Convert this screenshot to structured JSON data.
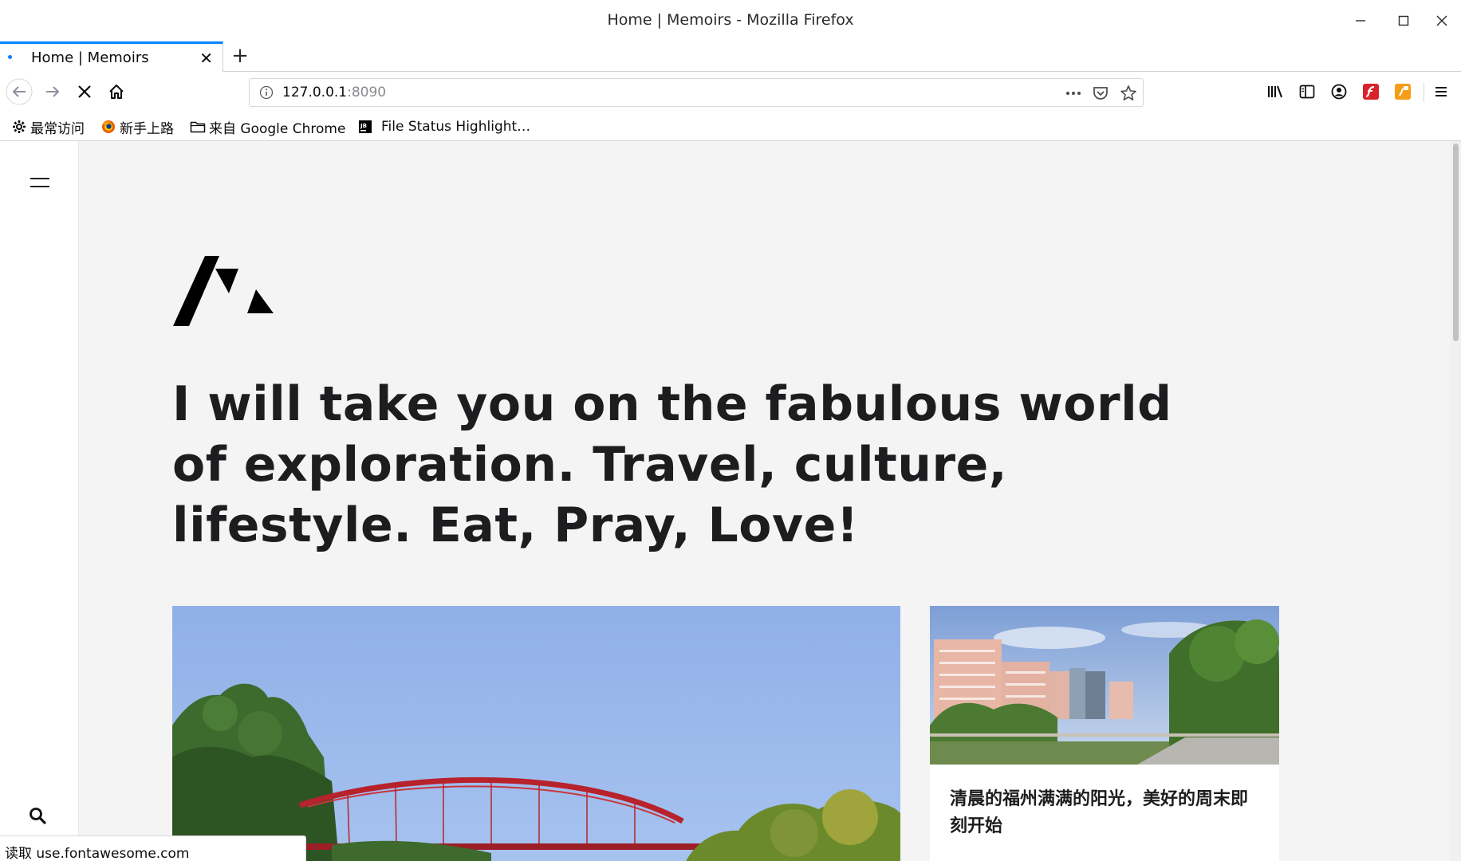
{
  "window": {
    "title": "Home | Memoirs - Mozilla Firefox",
    "minimize_icon": "minimize-icon",
    "maximize_icon": "maximize-icon",
    "close_icon": "close-icon"
  },
  "tab": {
    "label": "Home | Memoirs",
    "close_symbol": "✕"
  },
  "new_tab_symbol": "+",
  "urlbar": {
    "host": "127.0.0.1",
    "port": ":8090"
  },
  "bookmarks": [
    {
      "label": "最常访问",
      "icon": "gear-icon"
    },
    {
      "label": "新手上路",
      "icon": "firefox-icon"
    },
    {
      "label": "来自 Google Chrome",
      "icon": "folder-icon"
    },
    {
      "label": "File Status Highlight…",
      "icon": "jetbrains-icon"
    }
  ],
  "page": {
    "headline": "I will take you on the fabulous world of exploration. Travel, culture, lifestyle. Eat, Pray, Love!",
    "side_card_title": "清晨的福州满满的阳光，美好的周末即刻开始"
  },
  "status_bar": "读取 use.fontawesome.com",
  "colors": {
    "accent": "#0a84ff",
    "page_background": "#f4f4f4",
    "headline": "#1d1d1f"
  }
}
